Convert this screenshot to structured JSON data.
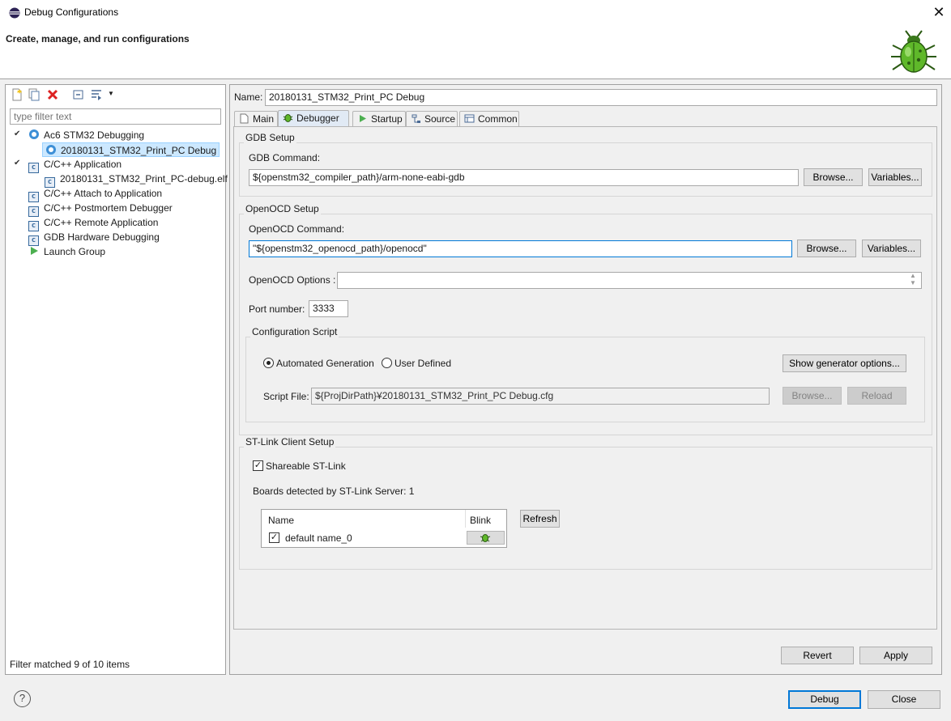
{
  "window": {
    "title": "Debug Configurations",
    "banner_title": "Create, manage, and run configurations"
  },
  "left": {
    "filter_placeholder": "type filter text",
    "tree": [
      {
        "label": "Ac6 STM32 Debugging",
        "icon": "ac6-debug-icon"
      },
      {
        "label": "20180131_STM32_Print_PC Debug",
        "icon": "ac6-config-icon",
        "selected": true
      },
      {
        "label": "C/C++ Application",
        "icon": "c-app-icon"
      },
      {
        "label": "20180131_STM32_Print_PC-debug.elf",
        "icon": "c-config-icon"
      },
      {
        "label": "C/C++ Attach to Application",
        "icon": "c-attach-icon"
      },
      {
        "label": "C/C++ Postmortem Debugger",
        "icon": "c-postmortem-icon"
      },
      {
        "label": "C/C++ Remote Application",
        "icon": "c-remote-icon"
      },
      {
        "label": "GDB Hardware Debugging",
        "icon": "gdb-hw-icon"
      },
      {
        "label": "Launch Group",
        "icon": "launch-group-icon"
      }
    ],
    "status": "Filter matched 9 of 10 items"
  },
  "right": {
    "name_label": "Name:",
    "name_value": "20180131_STM32_Print_PC Debug",
    "tabs": [
      "Main",
      "Debugger",
      "Startup",
      "Source",
      "Common"
    ],
    "gdb": {
      "group": "GDB Setup",
      "command_label": "GDB Command:",
      "command_value": "${openstm32_compiler_path}/arm-none-eabi-gdb",
      "browse": "Browse...",
      "variables": "Variables..."
    },
    "openocd": {
      "group": "OpenOCD Setup",
      "command_label": "OpenOCD Command:",
      "command_value": "\"${openstm32_openocd_path}/openocd\"",
      "browse": "Browse...",
      "variables": "Variables...",
      "options_label": "OpenOCD Options :",
      "options_value": "",
      "port_label": "Port number:",
      "port_value": "3333"
    },
    "script": {
      "group": "Configuration Script",
      "radio_auto": "Automated Generation",
      "radio_user": "User Defined",
      "show_options": "Show generator options...",
      "file_label": "Script File:",
      "file_value": "${ProjDirPath}¥20180131_STM32_Print_PC Debug.cfg",
      "browse": "Browse...",
      "reload": "Reload"
    },
    "stlink": {
      "group": "ST-Link Client Setup",
      "shareable": "Shareable ST-Link",
      "boards": "Boards detected by ST-Link Server: 1",
      "col_name": "Name",
      "col_blink": "Blink",
      "row_name": "default name_0",
      "refresh": "Refresh"
    },
    "revert": "Revert",
    "apply": "Apply"
  },
  "footer": {
    "help": "?",
    "debug": "Debug",
    "close": "Close"
  },
  "colors": {
    "accent": "#0078d7",
    "selection": "#cce8ff"
  }
}
